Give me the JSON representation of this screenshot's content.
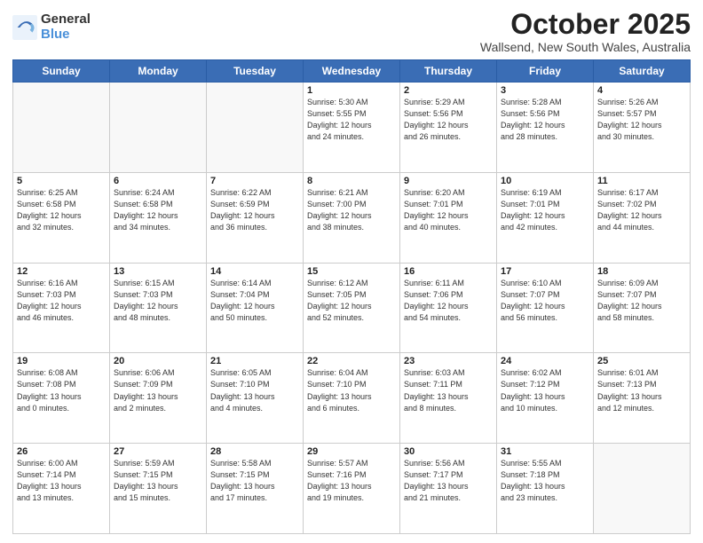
{
  "logo": {
    "general": "General",
    "blue": "Blue"
  },
  "header": {
    "month": "October 2025",
    "location": "Wallsend, New South Wales, Australia"
  },
  "days": [
    "Sunday",
    "Monday",
    "Tuesday",
    "Wednesday",
    "Thursday",
    "Friday",
    "Saturday"
  ],
  "weeks": [
    [
      {
        "day": "",
        "text": ""
      },
      {
        "day": "",
        "text": ""
      },
      {
        "day": "",
        "text": ""
      },
      {
        "day": "1",
        "text": "Sunrise: 5:30 AM\nSunset: 5:55 PM\nDaylight: 12 hours\nand 24 minutes."
      },
      {
        "day": "2",
        "text": "Sunrise: 5:29 AM\nSunset: 5:56 PM\nDaylight: 12 hours\nand 26 minutes."
      },
      {
        "day": "3",
        "text": "Sunrise: 5:28 AM\nSunset: 5:56 PM\nDaylight: 12 hours\nand 28 minutes."
      },
      {
        "day": "4",
        "text": "Sunrise: 5:26 AM\nSunset: 5:57 PM\nDaylight: 12 hours\nand 30 minutes."
      }
    ],
    [
      {
        "day": "5",
        "text": "Sunrise: 6:25 AM\nSunset: 6:58 PM\nDaylight: 12 hours\nand 32 minutes."
      },
      {
        "day": "6",
        "text": "Sunrise: 6:24 AM\nSunset: 6:58 PM\nDaylight: 12 hours\nand 34 minutes."
      },
      {
        "day": "7",
        "text": "Sunrise: 6:22 AM\nSunset: 6:59 PM\nDaylight: 12 hours\nand 36 minutes."
      },
      {
        "day": "8",
        "text": "Sunrise: 6:21 AM\nSunset: 7:00 PM\nDaylight: 12 hours\nand 38 minutes."
      },
      {
        "day": "9",
        "text": "Sunrise: 6:20 AM\nSunset: 7:01 PM\nDaylight: 12 hours\nand 40 minutes."
      },
      {
        "day": "10",
        "text": "Sunrise: 6:19 AM\nSunset: 7:01 PM\nDaylight: 12 hours\nand 42 minutes."
      },
      {
        "day": "11",
        "text": "Sunrise: 6:17 AM\nSunset: 7:02 PM\nDaylight: 12 hours\nand 44 minutes."
      }
    ],
    [
      {
        "day": "12",
        "text": "Sunrise: 6:16 AM\nSunset: 7:03 PM\nDaylight: 12 hours\nand 46 minutes."
      },
      {
        "day": "13",
        "text": "Sunrise: 6:15 AM\nSunset: 7:03 PM\nDaylight: 12 hours\nand 48 minutes."
      },
      {
        "day": "14",
        "text": "Sunrise: 6:14 AM\nSunset: 7:04 PM\nDaylight: 12 hours\nand 50 minutes."
      },
      {
        "day": "15",
        "text": "Sunrise: 6:12 AM\nSunset: 7:05 PM\nDaylight: 12 hours\nand 52 minutes."
      },
      {
        "day": "16",
        "text": "Sunrise: 6:11 AM\nSunset: 7:06 PM\nDaylight: 12 hours\nand 54 minutes."
      },
      {
        "day": "17",
        "text": "Sunrise: 6:10 AM\nSunset: 7:07 PM\nDaylight: 12 hours\nand 56 minutes."
      },
      {
        "day": "18",
        "text": "Sunrise: 6:09 AM\nSunset: 7:07 PM\nDaylight: 12 hours\nand 58 minutes."
      }
    ],
    [
      {
        "day": "19",
        "text": "Sunrise: 6:08 AM\nSunset: 7:08 PM\nDaylight: 13 hours\nand 0 minutes."
      },
      {
        "day": "20",
        "text": "Sunrise: 6:06 AM\nSunset: 7:09 PM\nDaylight: 13 hours\nand 2 minutes."
      },
      {
        "day": "21",
        "text": "Sunrise: 6:05 AM\nSunset: 7:10 PM\nDaylight: 13 hours\nand 4 minutes."
      },
      {
        "day": "22",
        "text": "Sunrise: 6:04 AM\nSunset: 7:10 PM\nDaylight: 13 hours\nand 6 minutes."
      },
      {
        "day": "23",
        "text": "Sunrise: 6:03 AM\nSunset: 7:11 PM\nDaylight: 13 hours\nand 8 minutes."
      },
      {
        "day": "24",
        "text": "Sunrise: 6:02 AM\nSunset: 7:12 PM\nDaylight: 13 hours\nand 10 minutes."
      },
      {
        "day": "25",
        "text": "Sunrise: 6:01 AM\nSunset: 7:13 PM\nDaylight: 13 hours\nand 12 minutes."
      }
    ],
    [
      {
        "day": "26",
        "text": "Sunrise: 6:00 AM\nSunset: 7:14 PM\nDaylight: 13 hours\nand 13 minutes."
      },
      {
        "day": "27",
        "text": "Sunrise: 5:59 AM\nSunset: 7:15 PM\nDaylight: 13 hours\nand 15 minutes."
      },
      {
        "day": "28",
        "text": "Sunrise: 5:58 AM\nSunset: 7:15 PM\nDaylight: 13 hours\nand 17 minutes."
      },
      {
        "day": "29",
        "text": "Sunrise: 5:57 AM\nSunset: 7:16 PM\nDaylight: 13 hours\nand 19 minutes."
      },
      {
        "day": "30",
        "text": "Sunrise: 5:56 AM\nSunset: 7:17 PM\nDaylight: 13 hours\nand 21 minutes."
      },
      {
        "day": "31",
        "text": "Sunrise: 5:55 AM\nSunset: 7:18 PM\nDaylight: 13 hours\nand 23 minutes."
      },
      {
        "day": "",
        "text": ""
      }
    ]
  ]
}
